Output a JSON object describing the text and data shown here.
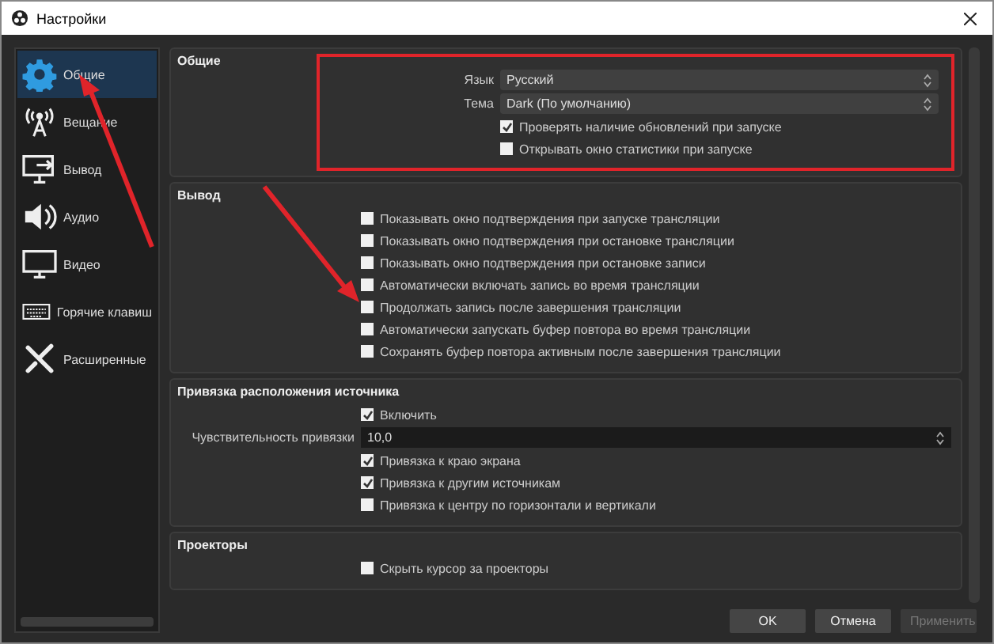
{
  "window": {
    "title": "Настройки"
  },
  "sidebar": {
    "items": [
      {
        "label": "Общие",
        "selected": true
      },
      {
        "label": "Вещание",
        "selected": false
      },
      {
        "label": "Вывод",
        "selected": false
      },
      {
        "label": "Аудио",
        "selected": false
      },
      {
        "label": "Видео",
        "selected": false
      },
      {
        "label": "Горячие клавиш",
        "selected": false
      },
      {
        "label": "Расширенные",
        "selected": false
      }
    ]
  },
  "groups": [
    {
      "title": "Общие",
      "highlighted": true,
      "rows": [
        {
          "kind": "select",
          "label": "Язык",
          "value": "Русский"
        },
        {
          "kind": "select",
          "label": "Тема",
          "value": "Dark (По умолчанию)"
        },
        {
          "kind": "checkbox",
          "label": "Проверять наличие обновлений при запуске",
          "checked": true
        },
        {
          "kind": "checkbox",
          "label": "Открывать окно статистики при запуске",
          "checked": false
        }
      ]
    },
    {
      "title": "Вывод",
      "highlighted": false,
      "rows": [
        {
          "kind": "checkbox",
          "label": "Показывать окно подтверждения при запуске трансляции",
          "checked": false
        },
        {
          "kind": "checkbox",
          "label": "Показывать окно подтверждения при остановке трансляции",
          "checked": false
        },
        {
          "kind": "checkbox",
          "label": "Показывать окно подтверждения при остановке записи",
          "checked": false
        },
        {
          "kind": "checkbox",
          "label": "Автоматически включать запись во время трансляции",
          "checked": false
        },
        {
          "kind": "checkbox",
          "label": "Продолжать запись после завершения трансляции",
          "checked": false
        },
        {
          "kind": "checkbox",
          "label": "Автоматически запускать буфер повтора во время трансляции",
          "checked": false
        },
        {
          "kind": "checkbox",
          "label": "Сохранять буфер повтора активным после завершения трансляции",
          "checked": false
        }
      ]
    },
    {
      "title": "Привязка расположения источника",
      "highlighted": false,
      "rows": [
        {
          "kind": "checkbox",
          "label": "Включить",
          "checked": true
        },
        {
          "kind": "number",
          "label": "Чувствительность привязки",
          "value": "10,0"
        },
        {
          "kind": "checkbox",
          "label": "Привязка к краю экрана",
          "checked": true
        },
        {
          "kind": "checkbox",
          "label": "Привязка к другим источникам",
          "checked": true
        },
        {
          "kind": "checkbox",
          "label": "Привязка к центру по горизонтали и вертикали",
          "checked": false
        }
      ]
    },
    {
      "title": "Проекторы",
      "highlighted": false,
      "rows": [
        {
          "kind": "checkbox",
          "label": "Скрыть курсор за проекторы",
          "checked": false
        }
      ]
    }
  ],
  "buttons": [
    {
      "label": "OK",
      "disabled": false
    },
    {
      "label": "Отмена",
      "disabled": false
    },
    {
      "label": "Применить",
      "disabled": true
    }
  ]
}
